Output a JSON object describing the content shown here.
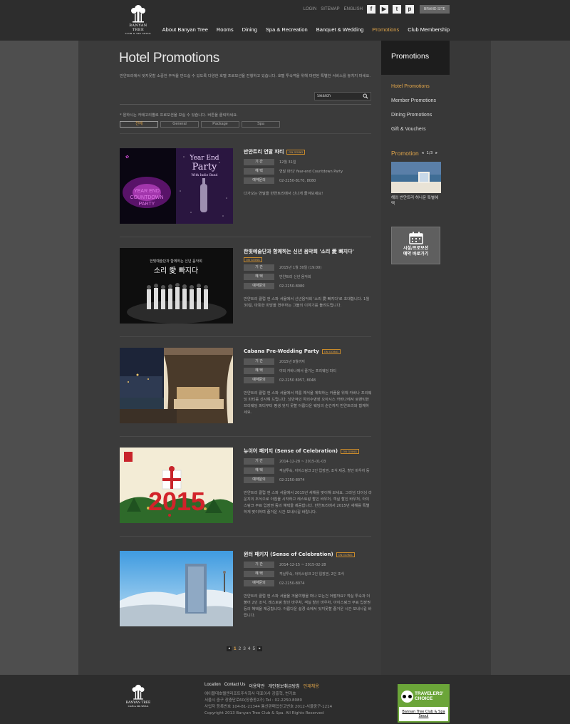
{
  "header": {
    "brand_name": "BANYAN TREE",
    "brand_sub": "CLUB & SPA SEOUL",
    "utility_links": [
      "LOGIN",
      "SITEMAP",
      "ENGLISH"
    ],
    "sns": [
      {
        "name": "facebook-icon",
        "glyph": "f"
      },
      {
        "name": "youtube-icon",
        "glyph": "▶"
      },
      {
        "name": "twitter-icon",
        "glyph": "t"
      },
      {
        "name": "pinterest-icon",
        "glyph": "p"
      }
    ],
    "brand_site_label": "BRAND SITE",
    "nav": [
      "About Banyan Tree",
      "Rooms",
      "Dining",
      "Spa & Recreation",
      "Banquet & Wedding",
      "Promotions",
      "Club Membership"
    ],
    "nav_active_index": 5
  },
  "main": {
    "title": "Hotel Promotions",
    "intro": "반얀트리에서 잊지못할 소중한 추억을 만드실 수 있도록 다양한 호텔 프로모션을 진행하고 있습니다. 호텔 투숙객을 위해 마련된 특별한 서비스를 놓치지 마세요.",
    "search_placeholder": "Search",
    "note": "* 원하시는 카테고리별로 프로모션을 보실 수 있습니다. 버튼을 클릭하세요.",
    "categories": [
      "전체",
      "General",
      "Package",
      "Spa"
    ],
    "category_active_index": 0,
    "labels": {
      "period": "기 간",
      "benefit": "혜 택",
      "inquiry": "예약문의"
    },
    "badge": "ON GOING",
    "promotions": [
      {
        "title": "반얀트리 연말 파티",
        "badge_below": false,
        "period": "12월 31일",
        "benefit": "연말 파티/ Year-end Countdown Party",
        "inquiry": "02-2250-8170, 8080",
        "desc": "다가오는 연말을 반얀트리에서 신나게 즐겨보세요!",
        "thumb_text": [
          "Year End",
          "Party",
          "With Indie Band"
        ],
        "thumb_countdown": [
          "YEAR END",
          "COUNTDOWN",
          "PARTY"
        ]
      },
      {
        "title": "한빛예술단과 함께하는 신년 음악회 '소리 愛 빠지다'",
        "badge_below": true,
        "period": "2015년 1월 30일 (19:00)",
        "benefit": "반얀트리 신년 음악회",
        "inquiry": "02-2250-8080",
        "desc": "반얀트리 클럽 앤 스파 서울에서 신년음악회 '소리 愛 빠지다'로 초대합니다. 1월 30일, 따뜻한 희망을 연주하는 그들의 이야기를 들려드립니다.",
        "thumb_text": [
          "한빛예술단과 함께하는 신년 음악회",
          "소리 愛 빠지다"
        ]
      },
      {
        "title": "Cabana Pre-Wedding Party",
        "badge_below": false,
        "period": "2015년 8월까지",
        "benefit": "야외 카바나에서 즐기는 프리웨딩 파티",
        "inquiry": "02-2250 8057, 8048",
        "desc": "반얀트리 클럽 앤 스파 서울에서 여름 예식을 계획하는 커플을 위해 카바나 프리웨딩 파티를 선사해 드립니다. 낭만적인 야외수영장 오아시스 카바나에서 로맨틱한 프리웨딩 파티부터 평생 잊지 못할 아름다운 웨딩의 순간까지 반얀트리와 함께하세요."
      },
      {
        "title": "뉴이어 패키지 (Sense of Celebration)",
        "badge_below": false,
        "period": "2014-12-28 ~ 2015-01-03",
        "benefit": "객실투숙, 아이스링크 2인 입장권, 조식 제공, 할인 바우처 등",
        "inquiry": "02-2250-8074",
        "desc": "반얀트리 클럽 앤 스파 서울에서 2015년 새해를 맞이해 보세요. 그라넘 다이닝 라운지의 조식으로 아침을 시작하고 레스토랑 할인 바우처, 객실 할인 바우처, 아이스링크 무료 입장권 등의 혜택을 제공합니다. 반얀트리에서 2015년 새해를 특별하게 맞이하며 즐거운 시간 보내시길 바랍니다.",
        "thumb_year": "2015"
      },
      {
        "title": "윈터 패키지 (Sense of Celebration)",
        "badge_below": false,
        "period": "2014-12-15 ~ 2015-02-28",
        "benefit": "객실투숙, 아이스링크 2인 입장권, 2인 조식",
        "inquiry": "02-2250-8074",
        "desc": "반얀트리 클럽 앤 스파 서울을 겨울여행을 떠나 보는건 어떨까요? 객실 투숙과 더불어 2인 조식, 레스토랑 할인 바우처, 객실 할인 바우처, 아이스링크 무료 입장권 등의 혜택을 제공합니다. 아름다운 설경 속에서 잊지못할 즐거운 시간 보내시길 바랍니다."
      }
    ],
    "pager": {
      "prev": "◂",
      "next": "▸",
      "pages": [
        "1",
        "2",
        "3",
        "4",
        "5"
      ],
      "current": "1"
    }
  },
  "sidebar": {
    "title": "Promotions",
    "menu": [
      "Hotel Promotions",
      "Member Promotions",
      "Dining Promotions",
      "Gift & Vouchers"
    ],
    "menu_active_index": 0,
    "promo_title": "Promotion",
    "promo_prev": "◂",
    "promo_page": "1/3",
    "promo_next": "▸",
    "promo_caption": "해외 반얀트리 허니문 특별혜택",
    "reserve_label_1": "시설/프로모션",
    "reserve_label_2": "예약 바로가기"
  },
  "footer": {
    "links": [
      "Location",
      "Contact Us",
      "이용약관",
      "개인정보취급방침",
      "인재채용"
    ],
    "address_lines": [
      "에이블대호텔앤리조트주식회사 대표이사 강홍혁, 변기호",
      "서울시 중구 장충단로60(장충동2가) Tel : 02.2250.8080",
      "사업자 등록번호 104-81-21344 통신판매업신고번호 2012-서울중구-1214",
      "Copyright 2013 Banyan Tree Club & Spa. All Rights Reserved"
    ],
    "tripadvisor_line1": "TRAVELERS'",
    "tripadvisor_line2": "CHOICE",
    "tripadvisor_name": "Banyan Tree Club & Spa Seoul"
  },
  "colors": {
    "accent": "#e0a54a",
    "header_bg": "#2d2d2d",
    "page_bg": "#4e4e4e"
  }
}
